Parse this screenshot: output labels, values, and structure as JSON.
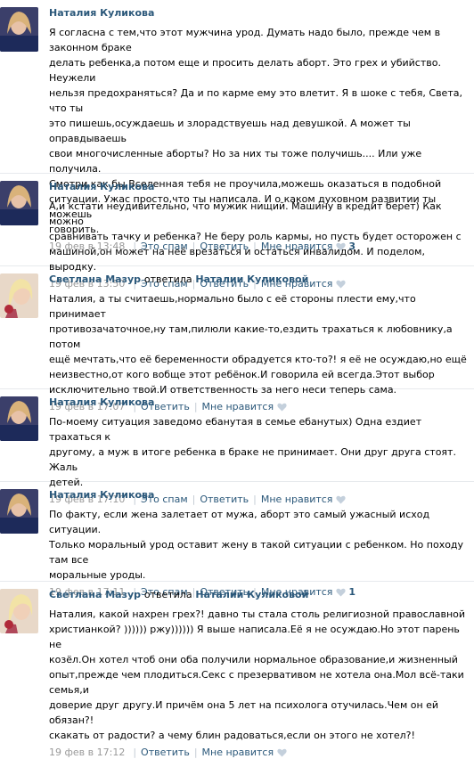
{
  "comments": [
    {
      "author": "Наталия Куликова",
      "text": "Я согласна с тем,что этот мужчина урод. Думать надо было, прежде чем в законном браке\nделать ребенка,а потом еще и просить делать аборт. Это грех и убийство. Неужели\nнельзя предохраняться? Да и по карме ему это влетит. Я в шоке с тебя, Света, что ты\nэто пишешь,осуждаешь и злорадствуешь над девушкой. А может ты оправдываешь\nсвои многочисленные аборты? Но за них ты тоже получишь.... Или уже получила.\nСмотри,как бы Вселенная тебя не проучила,можешь оказаться в подобной\nситуации. Ужас просто,что ты написала. И о каком духовном развитии ты можешь\nговорить.",
      "date": "19 фев в 13:48",
      "links": [
        "Это спам",
        "Ответить",
        "Мне нравится"
      ],
      "likes": "3"
    },
    {
      "author": "Наталия Куликова",
      "text": "А,и кстати неудивительно, что мужик нищий. Машину в кредит берет) Как можно\nсравнивать тачку и ребенка? Не беру роль кармы, но пусть будет осторожен с\nмашиной,он может на неё врезаться и остаться инвалидом. И поделом, выродку.",
      "date": "19 фев в 13:50",
      "links": [
        "Это спам",
        "Ответить",
        "Мне нравится"
      ],
      "likes": ""
    },
    {
      "author": "Светлана Мазур",
      "replied": "ответила",
      "reply_to": "Наталии Куликовой",
      "text": "Наталия, а ты считаешь,нормально было с её стороны плести ему,что принимает\nпротивозачаточное,ну там,пилюли какие-то,ездить трахаться к любовнику,а потом\nещё мечтать,что её беременности обрадуется кто-то?! я её не осуждаю,но ещё\nнеизвестно,от кого вобще этот ребёнок.И говорила ей всегда.Этот выбор\nисключительно твой.И ответственность за него неси теперь сама.",
      "date": "19 фев в 17:07",
      "links": [
        "Ответить",
        "Мне нравится"
      ],
      "likes": ""
    },
    {
      "author": "Наталия Куликова",
      "text": "По-моему ситуация заведомо ебанутая в семье ебанутых) Одна ездиет трахаться к\nдругому, а муж в итоге ребенка в браке не принимает. Они друг друга стоят. Жаль\nдетей.",
      "date": "19 фев в 17:10",
      "links": [
        "Это спам",
        "Ответить",
        "Мне нравится"
      ],
      "likes": ""
    },
    {
      "author": "Наталия Куликова",
      "text": "По факту, если жена залетает от мужа, аборт это самый ужасный исход ситуации.\nТолько моральный урод оставит жену в такой ситуации с ребенком. Но походу там все\nморальные уроды.",
      "date": "19 фев в 17:11",
      "links": [
        "Это спам",
        "Ответить",
        "Мне нравится"
      ],
      "likes": "1"
    },
    {
      "author": "Светлана Мазур",
      "replied": "ответила",
      "reply_to": "Наталии Куликовой",
      "text": "Наталия, какой нахрен грех?! давно ты стала столь религиозной православной\nхристианкой? )))))) ржу)))))) Я выше написала.Её я не осуждаю.Но этот парень не\nкозёл.Он хотел чтоб они оба получили нормальное образование,и жизненный\nопыт,прежде чем плодиться.Секс с презервативом не хотела она.Мол всё-таки семья,и\nдоверие друг другу.И причём она 5 лет на психолога отучилась.Чем он ей обязан?!\nскакать от радости? а чему блин радоваться,если он этого не хотел?!",
      "date": "19 фев в 17:12",
      "links": [
        "Ответить",
        "Мне нравится"
      ],
      "likes": ""
    }
  ],
  "colors": {
    "link": "#2b587a",
    "meta": "#999999",
    "separator": "#e7eaed",
    "heart": "#c4d0dc"
  },
  "icons": {
    "like": "heart-icon",
    "avatar": "user-photo"
  }
}
